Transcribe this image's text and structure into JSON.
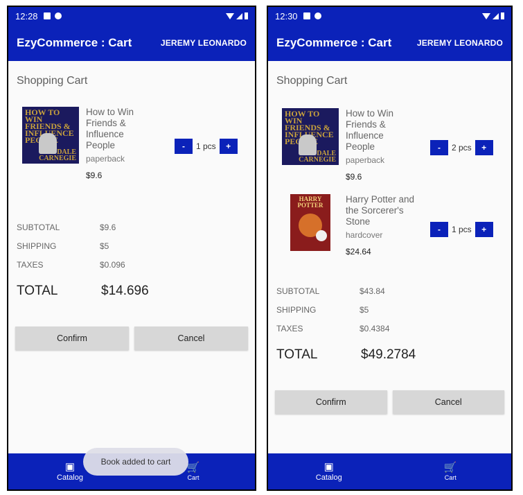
{
  "left": {
    "status": {
      "time": "12:28"
    },
    "app_bar": {
      "title": "EzyCommerce : Cart",
      "user": "JEREMY LEONARDO"
    },
    "section_title": "Shopping Cart",
    "items": [
      {
        "title": "How to Win Friends & Influence People",
        "format": "paperback",
        "price": "$9.6",
        "qty": "1 pcs",
        "cover_title": "HOW TO WIN FRIENDS & INFLUENCE PEOPLE",
        "cover_author": "DALE CARNEGIE"
      }
    ],
    "summary": {
      "subtotal_label": "SUBTOTAL",
      "subtotal": "$9.6",
      "shipping_label": "SHIPPING",
      "shipping": "$5",
      "taxes_label": "TAXES",
      "taxes": "$0.096",
      "total_label": "TOTAL",
      "total": "$14.696"
    },
    "buttons": {
      "confirm": "Confirm",
      "cancel": "Cancel"
    },
    "toast": "Book added to cart",
    "nav": {
      "catalog": "Catalog",
      "cart": "Cart"
    }
  },
  "right": {
    "status": {
      "time": "12:30"
    },
    "app_bar": {
      "title": "EzyCommerce : Cart",
      "user": "JEREMY LEONARDO"
    },
    "section_title": "Shopping Cart",
    "items": [
      {
        "title": "How to Win Friends & Influence People",
        "format": "paperback",
        "price": "$9.6",
        "qty": "2 pcs",
        "cover_title": "HOW TO WIN FRIENDS & INFLUENCE PEOPLE",
        "cover_author": "DALE CARNEGIE"
      },
      {
        "title": "Harry Potter and the Sorcerer's Stone",
        "format": "hardcover",
        "price": "$24.64",
        "qty": "1 pcs",
        "cover_title": "HARRY POTTER"
      }
    ],
    "summary": {
      "subtotal_label": "SUBTOTAL",
      "subtotal": "$43.84",
      "shipping_label": "SHIPPING",
      "shipping": "$5",
      "taxes_label": "TAXES",
      "taxes": "$0.4384",
      "total_label": "TOTAL",
      "total": "$49.2784"
    },
    "buttons": {
      "confirm": "Confirm",
      "cancel": "Cancel"
    },
    "nav": {
      "catalog": "Catalog",
      "cart": "Cart"
    }
  },
  "icons": {
    "catalog": "book-stack-icon",
    "cart": "shopping-cart-icon"
  },
  "colors": {
    "primary": "#0b22b9",
    "button_grey": "#d7d7d7"
  }
}
